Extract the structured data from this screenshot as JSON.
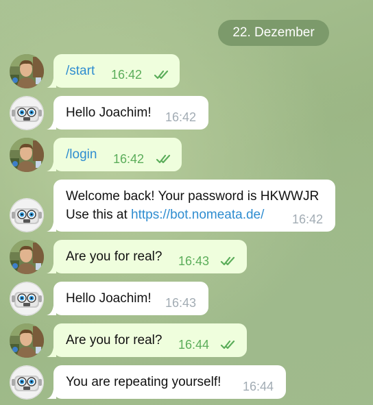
{
  "date_label": "22. Dezember",
  "messages": [
    {
      "text": "/start",
      "time": "16:42"
    },
    {
      "text": "Hello Joachim!",
      "time": "16:42"
    },
    {
      "text": "/login",
      "time": "16:42"
    },
    {
      "line1": "Welcome back! Your password is HKWWJR",
      "line2_prefix": "Use this at ",
      "link": "https://bot.nomeata.de/",
      "time": "16:42"
    },
    {
      "text": "Are you for real?",
      "time": "16:43"
    },
    {
      "text": "Hello Joachim!",
      "time": "16:43"
    },
    {
      "text": "Are you for real?",
      "time": "16:44"
    },
    {
      "text": "You are repeating yourself!",
      "time": "16:44"
    }
  ],
  "colors": {
    "outgoing_bubble": "#effedd",
    "incoming_bubble": "#ffffff",
    "link": "#2f8dd0",
    "read_ticks": "#5bad5a",
    "date_pill": "#7c9a6b"
  },
  "icons": {
    "user_avatar": "user-photo-avatar",
    "bot_avatar": "robot-face-avatar",
    "read_status": "double-check-icon"
  }
}
